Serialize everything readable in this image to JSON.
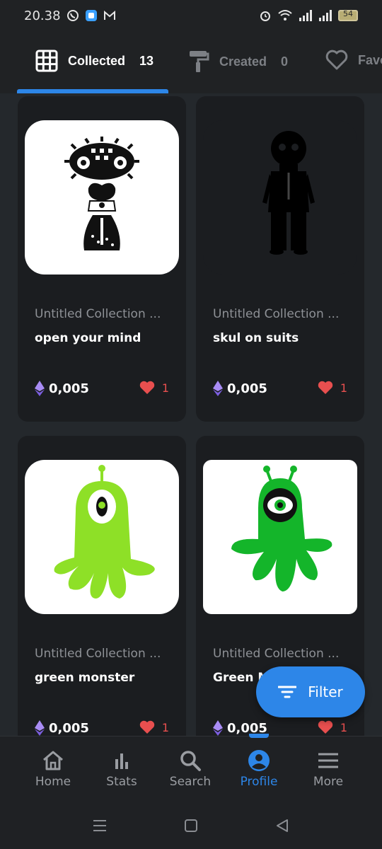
{
  "status_bar": {
    "time": "20.38",
    "battery": "54"
  },
  "tabs": [
    {
      "label": "Collected",
      "count": "13",
      "icon": "grid-icon",
      "active": true
    },
    {
      "label": "Created",
      "count": "0",
      "icon": "paint-roller-icon",
      "active": false
    },
    {
      "label": "Favo",
      "count": "",
      "icon": "heart-icon",
      "active": false
    }
  ],
  "cards": [
    {
      "collection": "Untitled Collection ...",
      "name": "open your mind",
      "price": "0,005",
      "likes": "1"
    },
    {
      "collection": "Untitled Collection ...",
      "name": "skul on suits",
      "price": "0,005",
      "likes": "1"
    },
    {
      "collection": "Untitled Collection ...",
      "name": "green monster",
      "price": "0,005",
      "likes": "1"
    },
    {
      "collection": "Untitled Collection ...",
      "name": "Green M",
      "price": "0,005",
      "likes": "1"
    }
  ],
  "filter": {
    "label": "Filter"
  },
  "nav": [
    {
      "label": "Home",
      "icon": "home-icon"
    },
    {
      "label": "Stats",
      "icon": "stats-icon"
    },
    {
      "label": "Search",
      "icon": "search-icon"
    },
    {
      "label": "Profile",
      "icon": "profile-icon",
      "active": true
    },
    {
      "label": "More",
      "icon": "menu-icon"
    }
  ],
  "colors": {
    "accent": "#2d86e8",
    "background": "#24282c",
    "card": "#1b1d20",
    "like": "#e84f4f",
    "monster_light": "#8ee027",
    "monster_dark": "#14b52a"
  }
}
